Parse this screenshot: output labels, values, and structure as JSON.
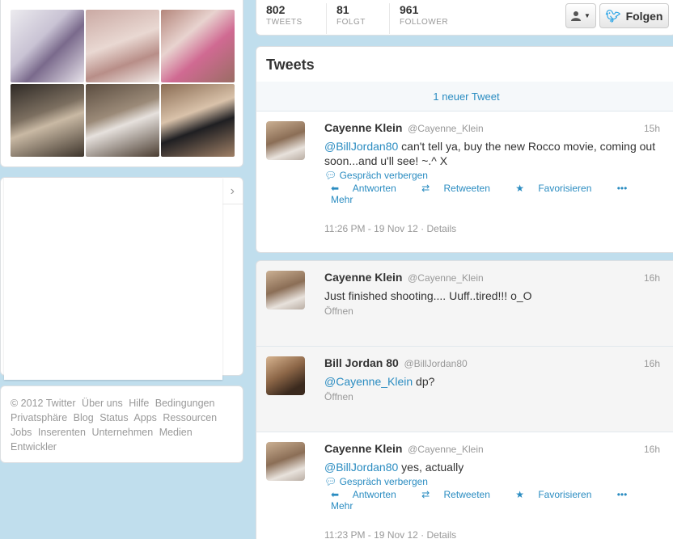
{
  "stats": [
    {
      "value": "802",
      "label": "TWEETS"
    },
    {
      "value": "81",
      "label": "FOLGT"
    },
    {
      "value": "961",
      "label": "FOLLOWER"
    }
  ],
  "follow_button": {
    "label": "Folgen"
  },
  "timeline": {
    "title": "Tweets",
    "new_tweets": "1 neuer Tweet"
  },
  "tweets": [
    {
      "name": "Cayenne Klein",
      "handle": "@Cayenne_Klein",
      "time": "15h",
      "mention": "@BillJordan80",
      "text": " can't tell ya, buy the new Rocco movie, coming out soon...and u'll see! ~.^ X",
      "conversation": "Gespräch verbergen",
      "actions": {
        "reply": "Antworten",
        "retweet": "Retweeten",
        "favorite": "Favorisieren",
        "more": "Mehr"
      },
      "date": "11:26 PM - 19 Nov 12 · Details"
    },
    {
      "name": "Cayenne Klein",
      "handle": "@Cayenne_Klein",
      "time": "16h",
      "text": "Just finished shooting.... Uuff..tired!!! o_O",
      "open": "Öffnen"
    },
    {
      "name": "Bill Jordan 80",
      "handle": "@BillJordan80",
      "time": "16h",
      "mention": "@Cayenne_Klein",
      "text": " dp?",
      "open": "Öffnen"
    },
    {
      "name": "Cayenne Klein",
      "handle": "@Cayenne_Klein",
      "time": "16h",
      "mention": "@BillJordan80",
      "text": " yes, actually",
      "conversation": "Gespräch verbergen",
      "actions": {
        "reply": "Antworten",
        "retweet": "Retweeten",
        "favorite": "Favorisieren",
        "more": "Mehr"
      },
      "date": "11:23 PM - 19 Nov 12 · Details"
    }
  ],
  "footer": [
    "© 2012 Twitter",
    "Über uns",
    "Hilfe",
    "Bedingungen",
    "Privatsphäre",
    "Blog",
    "Status",
    "Apps",
    "Ressourcen",
    "Jobs",
    "Inserenten",
    "Unternehmen",
    "Medien",
    "Entwickler"
  ],
  "colors": {
    "background": "#c0deed",
    "link": "#2a8cc1",
    "bird": "#2ea5e6"
  }
}
